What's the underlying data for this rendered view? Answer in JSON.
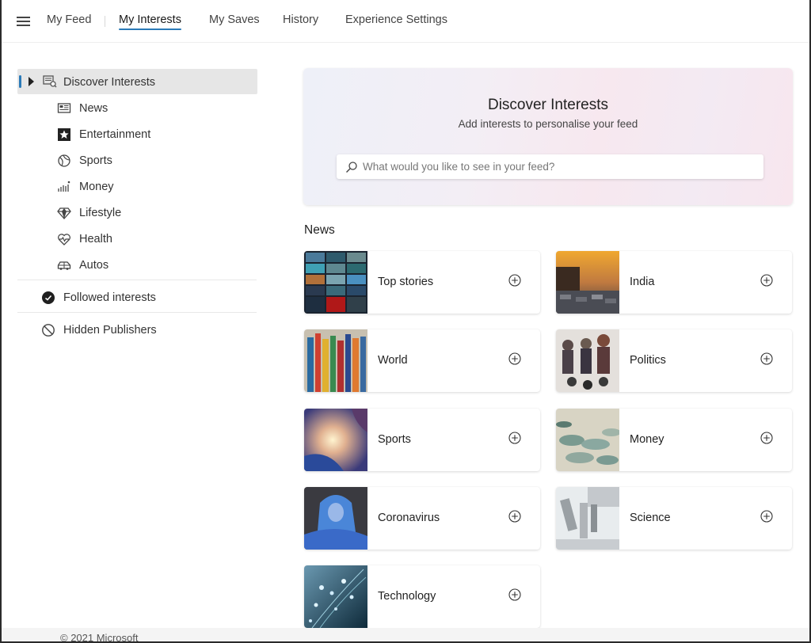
{
  "nav": {
    "menu_icon": "hamburger-icon",
    "items": [
      {
        "label": "My Feed",
        "active": false
      },
      {
        "label": "My Interests",
        "active": true
      },
      {
        "label": "My Saves",
        "active": false
      },
      {
        "label": "History",
        "active": false
      },
      {
        "label": "Experience Settings",
        "active": false
      }
    ],
    "accent_color": "#2a7ab8"
  },
  "sidebar": {
    "discover": {
      "label": "Discover Interests",
      "icon": "discover-icon",
      "expanded": true,
      "selected": true
    },
    "categories": [
      {
        "label": "News",
        "icon": "newspaper-icon"
      },
      {
        "label": "Entertainment",
        "icon": "star-icon"
      },
      {
        "label": "Sports",
        "icon": "ball-icon"
      },
      {
        "label": "Money",
        "icon": "chart-icon"
      },
      {
        "label": "Lifestyle",
        "icon": "diamond-icon"
      },
      {
        "label": "Health",
        "icon": "heart-pulse-icon"
      },
      {
        "label": "Autos",
        "icon": "car-icon"
      }
    ],
    "followed": {
      "label": "Followed interests",
      "icon": "check-circle-icon"
    },
    "hidden": {
      "label": "Hidden Publishers",
      "icon": "block-icon"
    }
  },
  "hero": {
    "title": "Discover Interests",
    "subtitle": "Add interests to personalise your feed",
    "search_placeholder": "What would you like to see in your feed?",
    "search_value": ""
  },
  "section": {
    "title": "News",
    "cards": [
      {
        "label": "Top stories",
        "image": "video-wall"
      },
      {
        "label": "India",
        "image": "sunset-traffic"
      },
      {
        "label": "World",
        "image": "flags"
      },
      {
        "label": "Politics",
        "image": "crowd-microphones"
      },
      {
        "label": "Sports",
        "image": "ball-splash"
      },
      {
        "label": "Money",
        "image": "coins"
      },
      {
        "label": "Coronavirus",
        "image": "protective-suit"
      },
      {
        "label": "Science",
        "image": "microscope"
      },
      {
        "label": "Technology",
        "image": "fiber-optics"
      }
    ]
  },
  "footer": {
    "copyright": "© 2021 Microsoft"
  }
}
